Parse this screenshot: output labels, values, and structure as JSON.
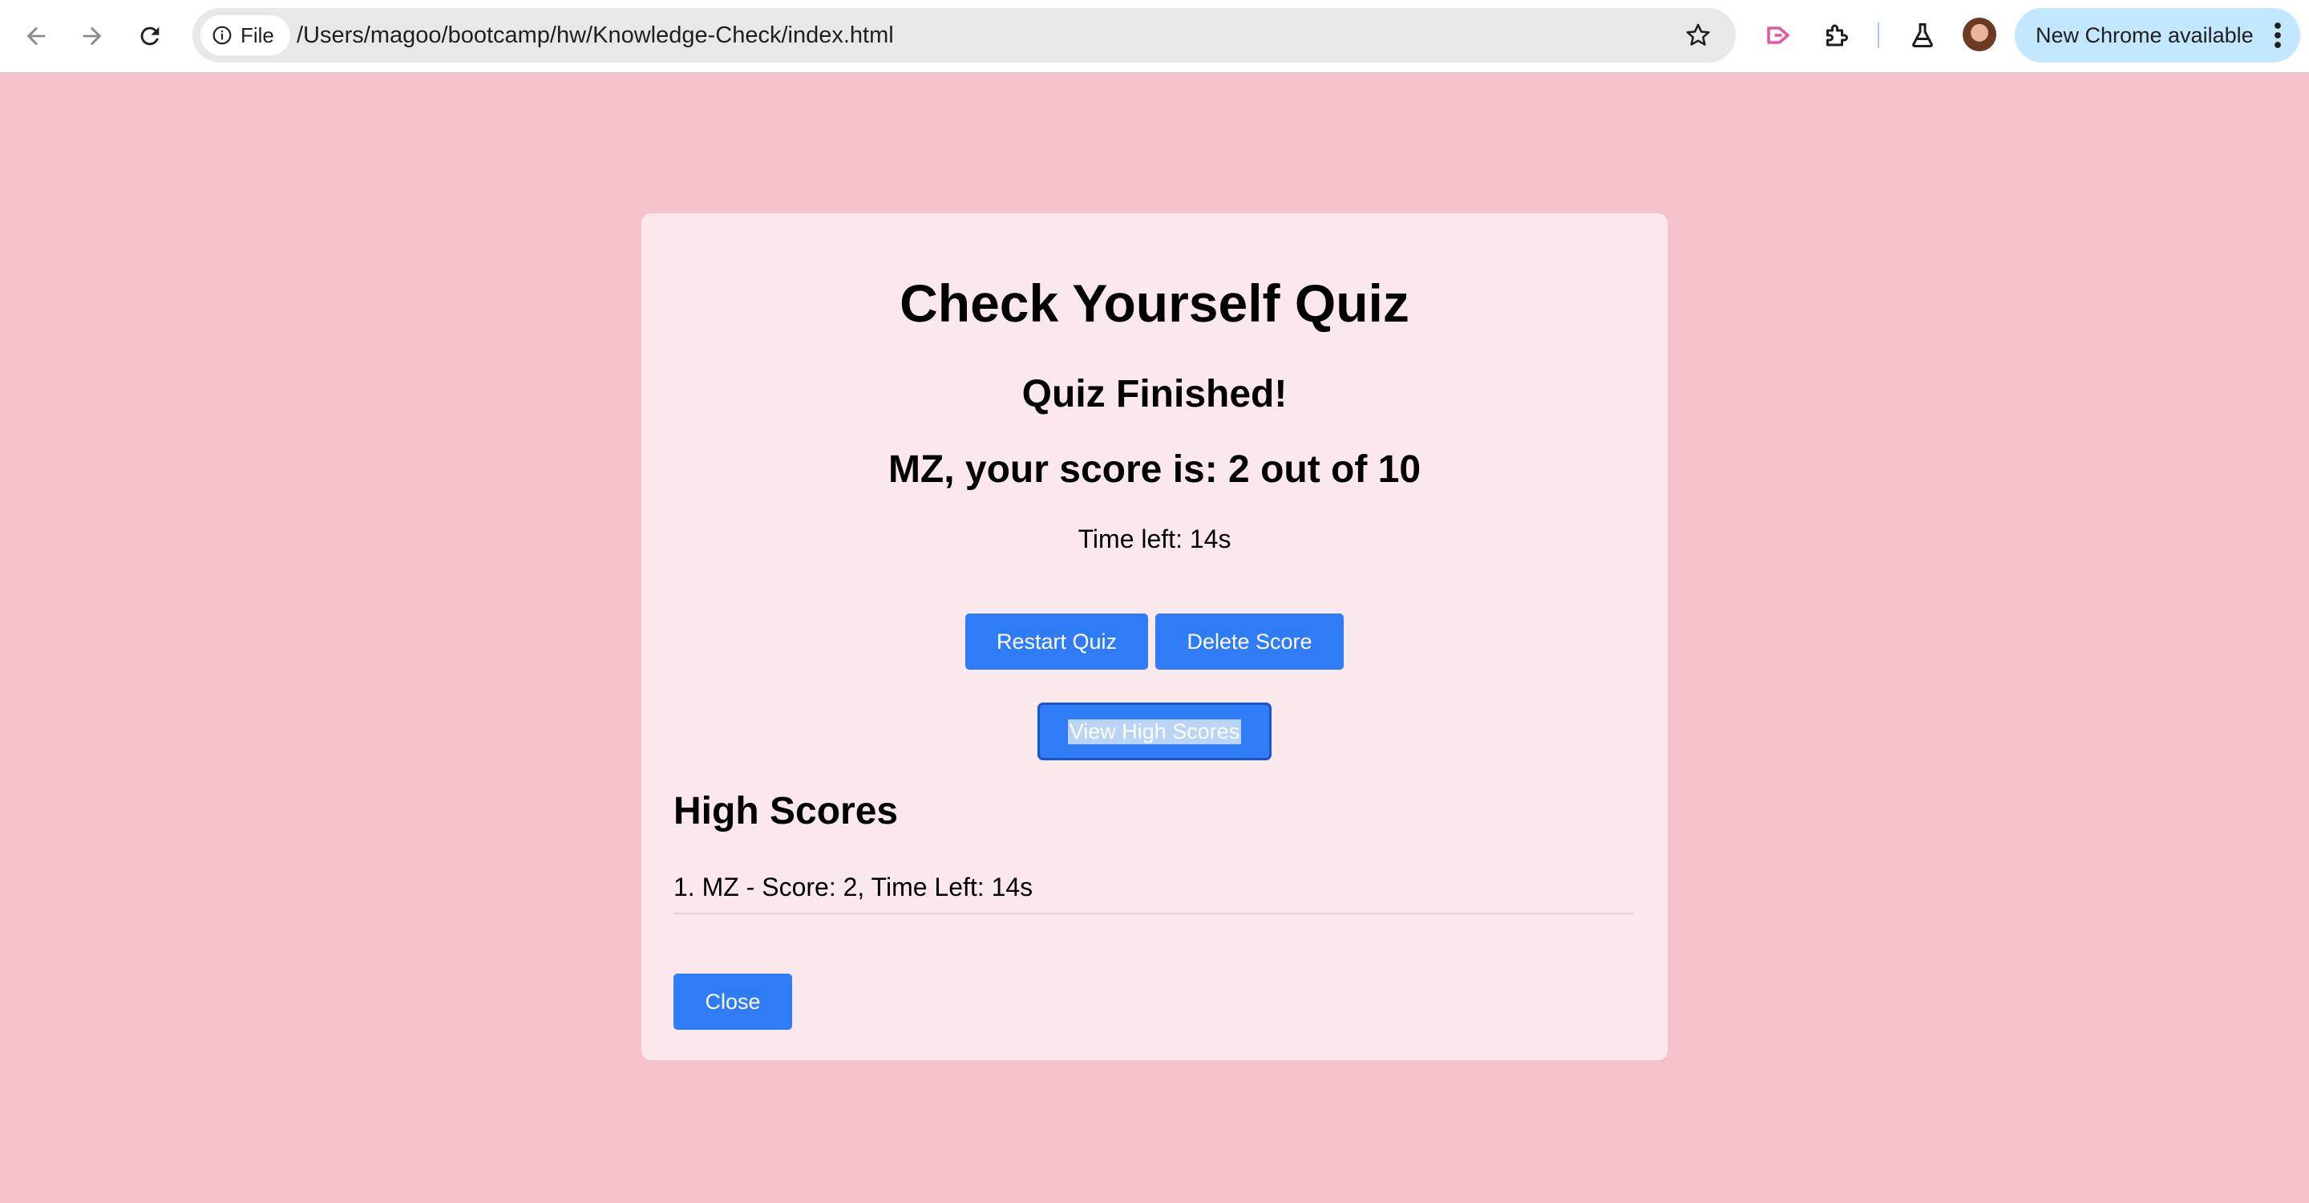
{
  "browser": {
    "chip_label": "File",
    "url": "/Users/magoo/bootcamp/hw/Knowledge-Check/index.html",
    "update_label": "New Chrome available",
    "icons": [
      "back-arrow-icon",
      "forward-arrow-icon",
      "reload-icon",
      "info-icon",
      "star-icon",
      "cast-icon",
      "extensions-icon",
      "labs-flask-icon",
      "profile-avatar",
      "kebab-menu-icon"
    ]
  },
  "quiz": {
    "title": "Check Yourself Quiz",
    "finished": "Quiz Finished!",
    "score_text": "MZ, your score is: 2 out of 10",
    "time_left": "Time left: 14s",
    "restart_label": "Restart Quiz",
    "delete_label": "Delete Score",
    "view_label": "View High Scores"
  },
  "high_scores": {
    "heading": "High Scores",
    "items": [
      "1. MZ - Score: 2, Time Left: 14s"
    ],
    "close_label": "Close"
  },
  "colors": {
    "page_background": "#f5c2cb",
    "card_background": "#fbe8ec",
    "button_blue": "#2f7cf6",
    "update_pill": "#c2e7ff"
  }
}
